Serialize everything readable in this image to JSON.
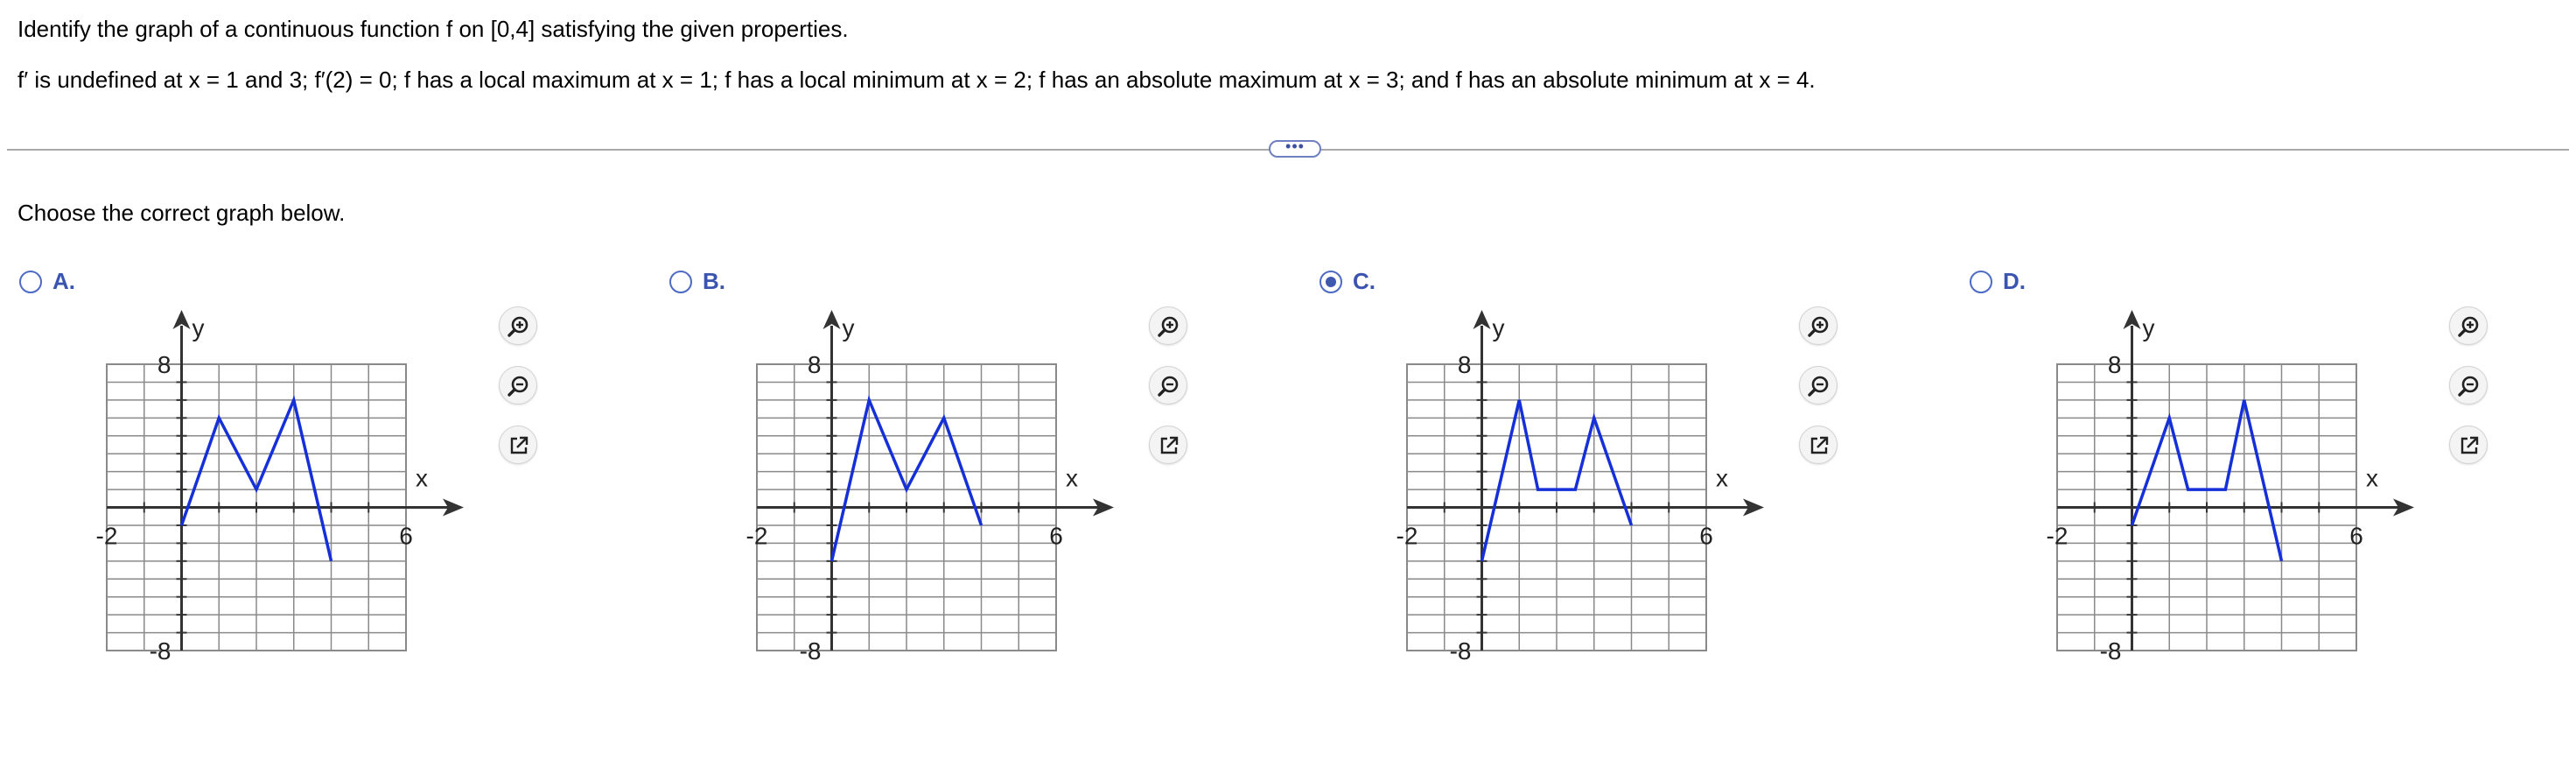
{
  "question": {
    "title": "Identify the graph of a continuous function f on [0,4] satisfying the given properties.",
    "properties": "f′ is undefined at x = 1 and 3; f′(2) = 0; f has a local maximum at x = 1; f has a local minimum at x = 2; f has an absolute maximum at x = 3; and f has an absolute minimum at x = 4."
  },
  "divider": {
    "handle_label": "•••"
  },
  "instruction": "Choose the correct graph below.",
  "options": [
    {
      "letter": "A.",
      "selected": false
    },
    {
      "letter": "B.",
      "selected": false
    },
    {
      "letter": "C.",
      "selected": true
    },
    {
      "letter": "D.",
      "selected": false
    }
  ],
  "tools": {
    "icons": [
      "zoom-in-icon",
      "zoom-out-icon",
      "open-new-window-icon"
    ]
  },
  "colors": {
    "curve": "#1530d8",
    "accent": "#3a54b0",
    "grid": "#8a8a8a",
    "axis": "#333333"
  },
  "chart_data": [
    {
      "type": "line",
      "x_axis_label": "x",
      "y_axis_label": "y",
      "xlim": [
        -2,
        6
      ],
      "ylim": [
        -8,
        8
      ],
      "x_tick_labels": [
        "-2",
        "6"
      ],
      "y_tick_labels": [
        "8",
        "-8"
      ],
      "grid": true,
      "series": [
        {
          "x": [
            0,
            1,
            2,
            3,
            4
          ],
          "y": [
            -1,
            5,
            1,
            6,
            -3
          ]
        }
      ]
    },
    {
      "type": "line",
      "x_axis_label": "x",
      "y_axis_label": "y",
      "xlim": [
        -2,
        6
      ],
      "ylim": [
        -8,
        8
      ],
      "x_tick_labels": [
        "-2",
        "6"
      ],
      "y_tick_labels": [
        "8",
        "-8"
      ],
      "grid": true,
      "series": [
        {
          "x": [
            0,
            1,
            2,
            3,
            4
          ],
          "y": [
            -3,
            6,
            1,
            5,
            -1
          ]
        }
      ]
    },
    {
      "type": "line",
      "x_axis_label": "x",
      "y_axis_label": "y",
      "xlim": [
        -2,
        6
      ],
      "ylim": [
        -8,
        8
      ],
      "x_tick_labels": [
        "-2",
        "6"
      ],
      "y_tick_labels": [
        "8",
        "-8"
      ],
      "grid": true,
      "series": [
        {
          "x": [
            0,
            1,
            1.5,
            2.5,
            3,
            4
          ],
          "y": [
            -3,
            6,
            1,
            1,
            5,
            -1
          ]
        }
      ]
    },
    {
      "type": "line",
      "x_axis_label": "x",
      "y_axis_label": "y",
      "xlim": [
        -2,
        6
      ],
      "ylim": [
        -8,
        8
      ],
      "x_tick_labels": [
        "-2",
        "6"
      ],
      "y_tick_labels": [
        "8",
        "-8"
      ],
      "grid": true,
      "series": [
        {
          "x": [
            0,
            1,
            1.5,
            2.5,
            3,
            4
          ],
          "y": [
            -1,
            5,
            1,
            1,
            6,
            -3
          ]
        }
      ]
    }
  ]
}
